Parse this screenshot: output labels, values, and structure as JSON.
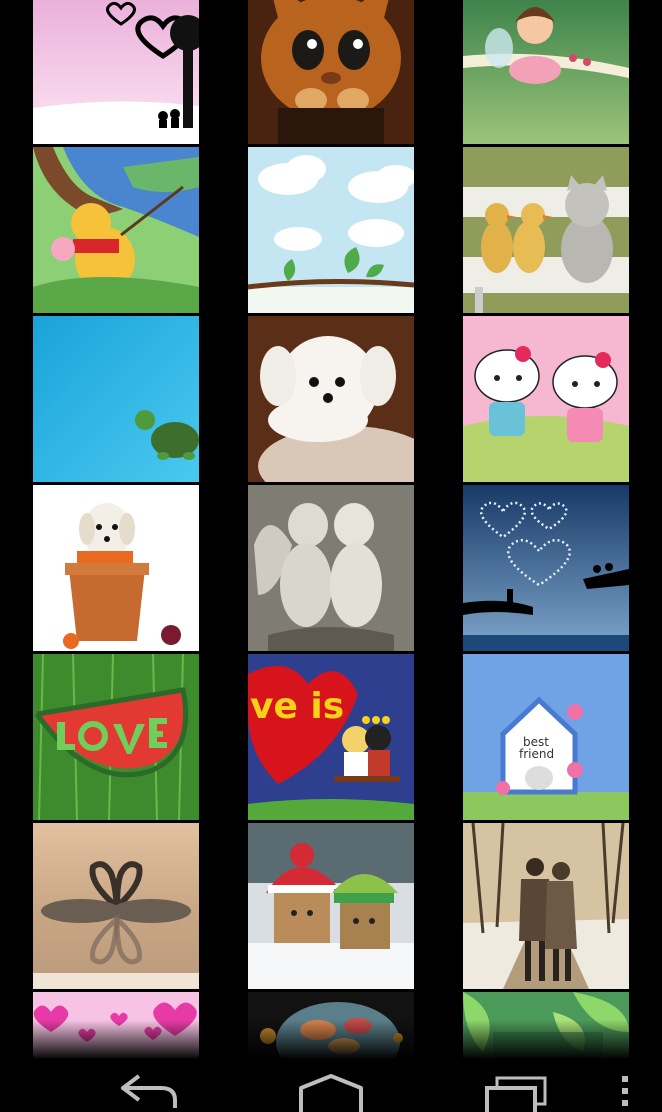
{
  "gallery": {
    "rows": [
      [
        {
          "name": "love-silhouette",
          "colors": [
            "#f6c8e4",
            "#fff"
          ]
        },
        {
          "name": "puss-in-boots-cat",
          "colors": [
            "#b35b1f",
            "#3c1d0c"
          ]
        },
        {
          "name": "fairy-girl-branch",
          "colors": [
            "#7fb36a",
            "#3f7a4a"
          ]
        }
      ],
      [
        {
          "name": "winnie-the-pooh",
          "colors": [
            "#6fb7d8",
            "#2f6fb0"
          ]
        },
        {
          "name": "cloud-sky-leaves",
          "colors": [
            "#c8e7f2",
            "#f4fbff"
          ]
        },
        {
          "name": "ducklings-and-kitten",
          "colors": [
            "#b8b49a",
            "#e9e6d8"
          ]
        }
      ],
      [
        {
          "name": "turtle-on-blue",
          "colors": [
            "#2fb6e2",
            "#0b87bd"
          ]
        },
        {
          "name": "white-puppy",
          "colors": [
            "#6a3a23",
            "#f4efe9"
          ]
        },
        {
          "name": "hello-kitty-pair",
          "colors": [
            "#f7b3d1",
            "#b7d17a"
          ]
        }
      ],
      [
        {
          "name": "puppy-in-flowerpot",
          "colors": [
            "#ffffff",
            "#c46b32"
          ]
        },
        {
          "name": "angel-statues-kiss",
          "colors": [
            "#a9a69f",
            "#e8e6e0"
          ]
        },
        {
          "name": "heart-stars-couple",
          "colors": [
            "#2b4e77",
            "#8bb0d3"
          ]
        }
      ],
      [
        {
          "name": "watermelon-love",
          "colors": [
            "#3f8a2e",
            "#76c34f"
          ]
        },
        {
          "name": "love-is-cartoon",
          "colors": [
            "#2d3f8a",
            "#d0131a"
          ]
        },
        {
          "name": "best-friend-doghouse",
          "colors": [
            "#6fa3e6",
            "#8cc85e"
          ]
        }
      ],
      [
        {
          "name": "swans-heart",
          "colors": [
            "#d8b899",
            "#7a6a5b"
          ]
        },
        {
          "name": "danbo-winter",
          "colors": [
            "#e8eef2",
            "#5a6b74"
          ]
        },
        {
          "name": "couple-walking-snow",
          "colors": [
            "#d9c6a5",
            "#6b5a45"
          ]
        }
      ],
      [
        {
          "name": "pink-hearts",
          "colors": [
            "#f7c0e4",
            "#e23fa8"
          ]
        },
        {
          "name": "bubble-dark",
          "colors": [
            "#1d1d1d",
            "#d57a44"
          ]
        },
        {
          "name": "green-leaves",
          "colors": [
            "#2b7c3e",
            "#8fd68a"
          ]
        }
      ]
    ]
  },
  "navbar": {
    "back_icon": "back-arrow-icon",
    "home_icon": "home-icon",
    "recents_icon": "recent-apps-icon",
    "menu_icon": "overflow-menu-icon"
  }
}
